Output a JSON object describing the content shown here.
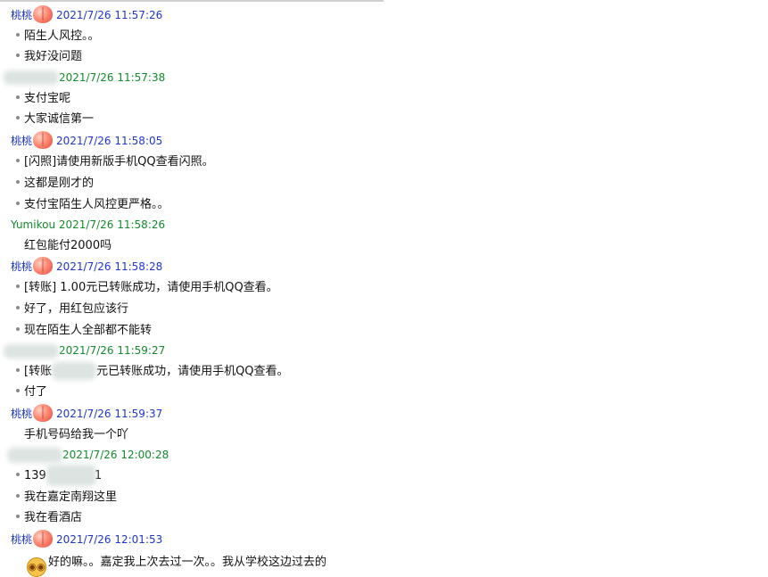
{
  "colors": {
    "self_name": "#1f37c8",
    "other_name": "#138a2b"
  },
  "rows": {
    "h1": {
      "name": "桃桃",
      "stamp": "2021/7/26 11:57:26"
    },
    "m1": "陌生人风控。。",
    "m2": "我好没问题",
    "h2": {
      "stamp": "2021/7/26 11:57:38"
    },
    "m3": "支付宝呢",
    "m4": "大家诚信第一",
    "h3": {
      "name": "桃桃",
      "stamp": "2021/7/26 11:58:05"
    },
    "m5": "[闪照]请使用新版手机QQ查看闪照。",
    "m6": "这都是刚才的",
    "m7": "支付宝陌生人风控更严格。。",
    "h4": {
      "name": "Yumikou",
      "stamp": "2021/7/26 11:58:26"
    },
    "m8": "红包能付2000吗",
    "h5": {
      "name": "桃桃",
      "stamp": "2021/7/26 11:58:28"
    },
    "m9": "[转账] 1.00元已转账成功，请使用手机QQ查看。",
    "m10": "好了，用红包应该行",
    "m11": "现在陌生人全部都不能转",
    "h6": {
      "stamp": "2021/7/26 11:59:27"
    },
    "m12a": "[转账",
    "m12b": "元已转账成功，请使用手机QQ查看。",
    "m13": "付了",
    "h7": {
      "name": "桃桃",
      "stamp": "2021/7/26 11:59:37"
    },
    "m14": "手机号码给我一个吖",
    "h8": {
      "stamp": "2021/7/26 12:00:28"
    },
    "m15a": "139",
    "m15b": "1",
    "m16": "我在嘉定南翔这里",
    "m17": "我在看酒店",
    "h9": {
      "name": "桃桃",
      "stamp": "2021/7/26 12:01:53"
    },
    "m18": "好的嘛。。嘉定我上次去过一次。。我从学校这边过去的"
  },
  "icons": {
    "peach": "peach-emoji-icon",
    "face": "surprised-face-emoji-icon"
  }
}
